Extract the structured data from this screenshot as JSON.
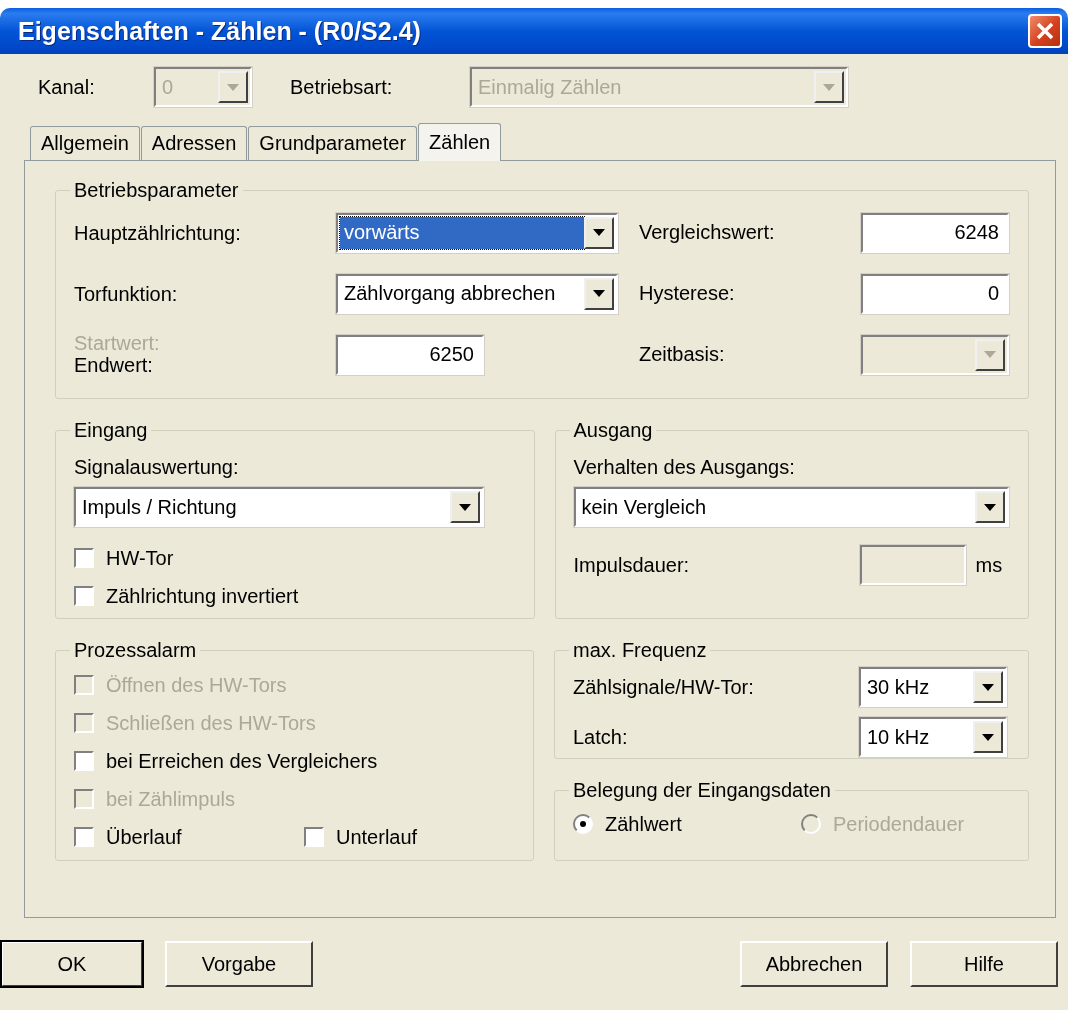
{
  "window": {
    "title": "Eigenschaften - Zählen - (R0/S2.4)"
  },
  "header": [
    {
      "label": "Kanal:",
      "value": "0",
      "disabled": true
    },
    {
      "label": "Betriebsart:",
      "value": "Einmalig Zählen",
      "disabled": true
    }
  ],
  "tabs": [
    {
      "label": "Allgemein",
      "selected": false
    },
    {
      "label": "Adressen",
      "selected": false
    },
    {
      "label": "Grundparameter",
      "selected": false
    },
    {
      "label": "Zählen",
      "selected": true
    }
  ],
  "betriebsparameter": {
    "title": "Betriebsparameter",
    "rows": [
      {
        "left": {
          "kind": "combo",
          "label": "Hauptzählrichtung:",
          "value": "vorwärts",
          "focused": true
        },
        "right": {
          "kind": "field",
          "label": "Vergleichswert:",
          "value": "6248",
          "disabled": false
        }
      },
      {
        "left": {
          "kind": "combo",
          "label": "Torfunktion:",
          "value": "Zählvorgang abbrechen",
          "focused": false
        },
        "right": {
          "kind": "field",
          "label": "Hysterese:",
          "value": "0",
          "disabled": false
        }
      },
      {
        "left": {
          "kind": "field",
          "over_label": {
            "text": "Startwert:",
            "disabled": true
          },
          "label": "Endwert:",
          "value": "6250",
          "disabled": false
        },
        "right": {
          "kind": "combo",
          "label": "Zeitbasis:",
          "disabled": true
        }
      }
    ]
  },
  "eingang": {
    "title": "Eingang",
    "label": "Signalauswertung:",
    "value": "Impuls / Richtung",
    "checkboxes": [
      {
        "label": "HW-Tor",
        "checked": false,
        "disabled": false
      },
      {
        "label": "Zählrichtung invertiert",
        "checked": false,
        "disabled": false
      }
    ]
  },
  "ausgang": {
    "title": "Ausgang",
    "label": "Verhalten des Ausgangs:",
    "value": "kein Vergleich",
    "field": {
      "label": "Impulsdauer:",
      "unit": "ms",
      "disabled": true
    }
  },
  "prozessalarm": {
    "title": "Prozessalarm",
    "rows": [
      [
        {
          "label": "Öffnen des HW-Tors",
          "checked": false,
          "disabled": true
        }
      ],
      [
        {
          "label": "Schließen des HW-Tors",
          "checked": false,
          "disabled": true
        }
      ],
      [
        {
          "label": "bei Erreichen des Vergleichers",
          "checked": false,
          "disabled": false
        }
      ],
      [
        {
          "label": "bei Zählimpuls",
          "checked": false,
          "disabled": true
        }
      ],
      [
        {
          "label": "Überlauf",
          "checked": false,
          "disabled": false
        },
        {
          "label": "Unterlauf",
          "checked": false,
          "disabled": false
        }
      ]
    ]
  },
  "max_frequenz": {
    "title": "max. Frequenz",
    "rows": [
      {
        "label": "Zählsignale/HW-Tor:",
        "value": "30 kHz"
      },
      {
        "label": "Latch:",
        "value": "10 kHz"
      }
    ]
  },
  "belegung": {
    "title": "Belegung der Eingangsdaten",
    "radios": [
      {
        "label": "Zählwert",
        "selected": true,
        "disabled": false
      },
      {
        "label": "Periodendauer",
        "selected": false,
        "disabled": true
      }
    ]
  },
  "buttons_left": [
    {
      "label": "OK",
      "default": true
    },
    {
      "label": "Vorgabe",
      "default": false
    }
  ],
  "buttons_right": [
    {
      "label": "Abbrechen",
      "default": false
    },
    {
      "label": "Hilfe",
      "default": false
    }
  ]
}
